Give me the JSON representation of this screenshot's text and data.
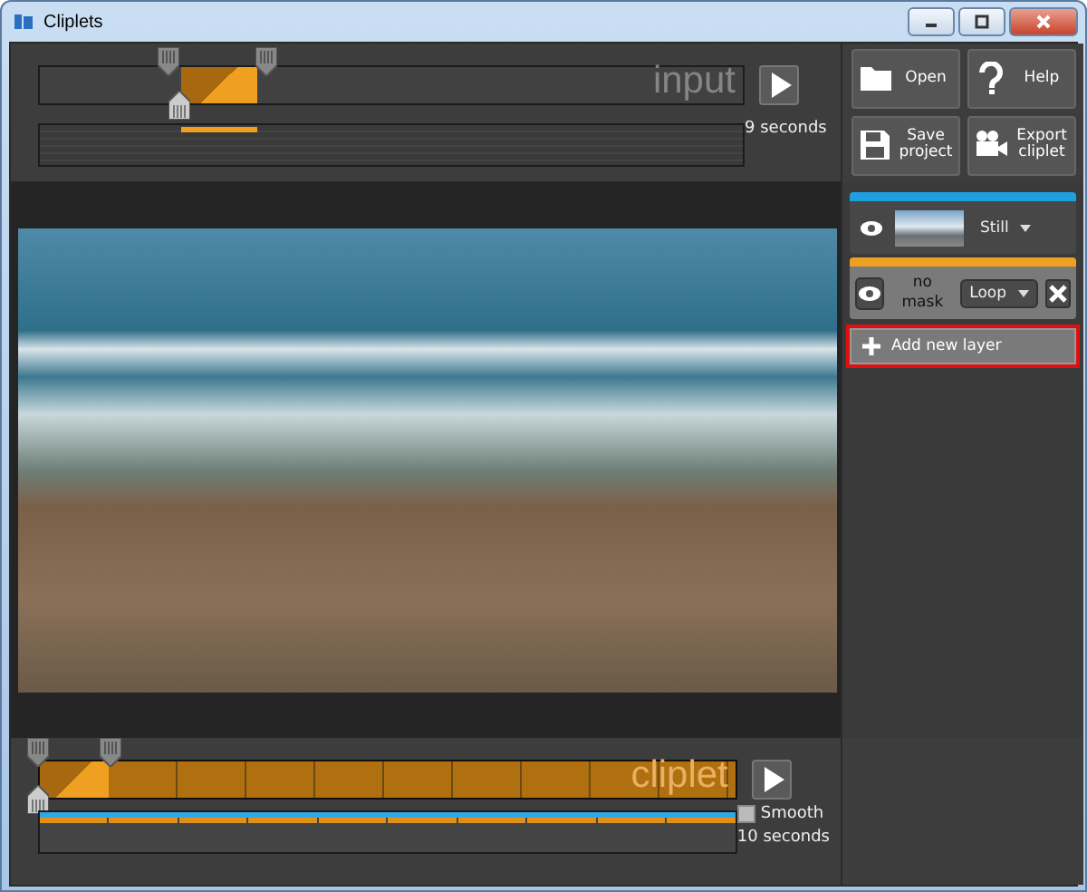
{
  "window": {
    "title": "Cliplets"
  },
  "input_timeline": {
    "watermark": "input",
    "duration": "9 seconds"
  },
  "toolbar": [
    {
      "kind": "open",
      "label": "Open"
    },
    {
      "kind": "help",
      "label": "Help"
    },
    {
      "kind": "save",
      "label": "Save project"
    },
    {
      "kind": "export",
      "label": "Export cliplet"
    }
  ],
  "layers": [
    {
      "kind": "still",
      "color": "#1e9fe0",
      "selected": false,
      "mode": "Still"
    },
    {
      "kind": "mask",
      "color": "#f0a020",
      "selected": true,
      "mask": "no mask",
      "mode": "Loop"
    }
  ],
  "add_layer": {
    "label": "Add new layer"
  },
  "cliplet_timeline": {
    "watermark": "cliplet",
    "smooth": {
      "label": "Smooth",
      "checked": false
    },
    "duration": "10 seconds"
  }
}
